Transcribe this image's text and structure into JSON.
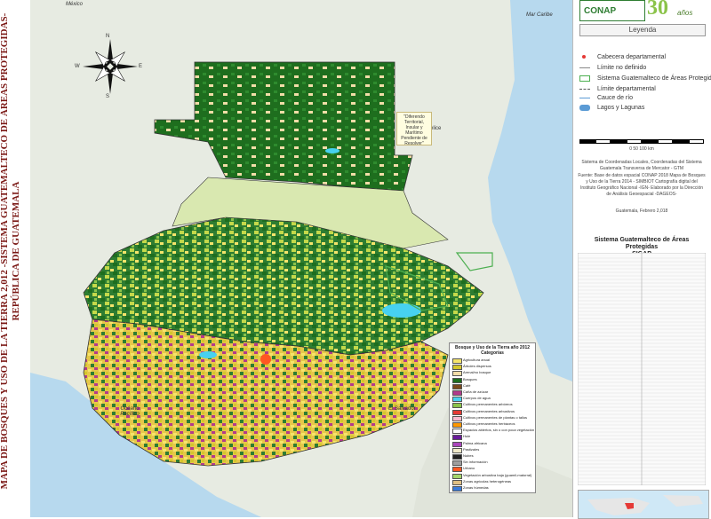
{
  "side_title": {
    "line1": "MAPA DE BOSQUES Y USO DE LA TIERRA 2,012 -SISTEMA GUATEMALTECO DE ÁREAS PROTEGIDAS-",
    "line2": "REPÚBLICA DE GUATEMALA"
  },
  "header": {
    "logo": "CONAP",
    "anniversary_number": "30",
    "anniversary_word": "años",
    "legend_title": "Leyenda"
  },
  "legend": [
    {
      "label": "Cabecera departamental",
      "symbol": "red-dot",
      "color": "#e53935"
    },
    {
      "label": "Límite no definido",
      "symbol": "line",
      "color": "#888888"
    },
    {
      "label": "Sistema Guatemalteco de Áreas Protegidas",
      "symbol": "green-box",
      "color": "#4caf50"
    },
    {
      "label": "Límite departamental",
      "symbol": "dashed-line",
      "color": "#555555"
    },
    {
      "label": "Cauce de río",
      "symbol": "blue-line",
      "color": "#5b9bd5"
    },
    {
      "label": "Lagos y Lagunas",
      "symbol": "lake",
      "color": "#5b9bd5"
    }
  ],
  "scale_text": "0 50 100 km",
  "projection_note": "Sistema de Coordenadas Locales, Coordenadas del Sistema Guatemala Transversa de Mercator - GTM",
  "source_note": "Fuente: Base de datos espacial CONAP 2018 Mapa de Bosques y Uso de la Tierra 2014 - SIMBIOT Cartografía digital del Instituto Geográfico Nacional -IGN- Elaborado por la Dirección de Análisis Geoespacial -DAGEOS-",
  "date_note": "Guatemala, Febrero 2,018",
  "sidap": {
    "title": "Sistema Guatemalteco de Áreas Protegidas",
    "subtitle": "-SIGAP-"
  },
  "map_labels": {
    "mexico": "México",
    "mar_caribe": "Mar Caribe",
    "belice": "Belice",
    "el_salvador": "El Salvador",
    "oceano": "Océano Pacífico",
    "disputed": "\"Diferendo Territorial, Insular y Marítimo Pendiente de Resolver\""
  },
  "compass": {
    "n": "N",
    "s": "S",
    "e": "E",
    "w": "W"
  },
  "categories_box": {
    "title": "Bosque y Uso de la Tierra año 2012",
    "subtitle": "Categorías",
    "items": [
      {
        "label": "Agricultura anual",
        "color": "#f5e46b"
      },
      {
        "label": "Árboles dispersos",
        "color": "#d4c62c"
      },
      {
        "label": "Arenal/no bosque",
        "color": "#f2dda8"
      },
      {
        "label": "Bosques",
        "color": "#1e6e1e"
      },
      {
        "label": "Café",
        "color": "#7a4a1c"
      },
      {
        "label": "Caña de azúcar",
        "color": "#b23a8c"
      },
      {
        "label": "Cuerpos de agua",
        "color": "#47d1f0"
      },
      {
        "label": "Cultivos permanentes arbóreos",
        "color": "#8bc34a"
      },
      {
        "label": "Cultivos permanentes arbustivos",
        "color": "#e53935"
      },
      {
        "label": "Cultivos permanentes de plantas o tallos",
        "color": "#f8bbd0"
      },
      {
        "label": "Cultivos permanentes herbáceos",
        "color": "#ff9800"
      },
      {
        "label": "Espacios abiertos, sin o con poca vegetación",
        "color": "#ffffff"
      },
      {
        "label": "Hule",
        "color": "#6a1b9a"
      },
      {
        "label": "Palma africana",
        "color": "#ab47bc"
      },
      {
        "label": "Pastizales",
        "color": "#f0e9c8"
      },
      {
        "label": "Nubes",
        "color": "#212121"
      },
      {
        "label": "Sin información",
        "color": "#9e9e9e"
      },
      {
        "label": "Urbano",
        "color": "#ff5722"
      },
      {
        "label": "Vegetación arbustiva baja (guamil-matorral)",
        "color": "#a5d66b"
      },
      {
        "label": "Zonas agrícolas heterogéneas",
        "color": "#e0c084"
      },
      {
        "label": "Zonas húmedas",
        "color": "#3a7ad9"
      }
    ]
  }
}
